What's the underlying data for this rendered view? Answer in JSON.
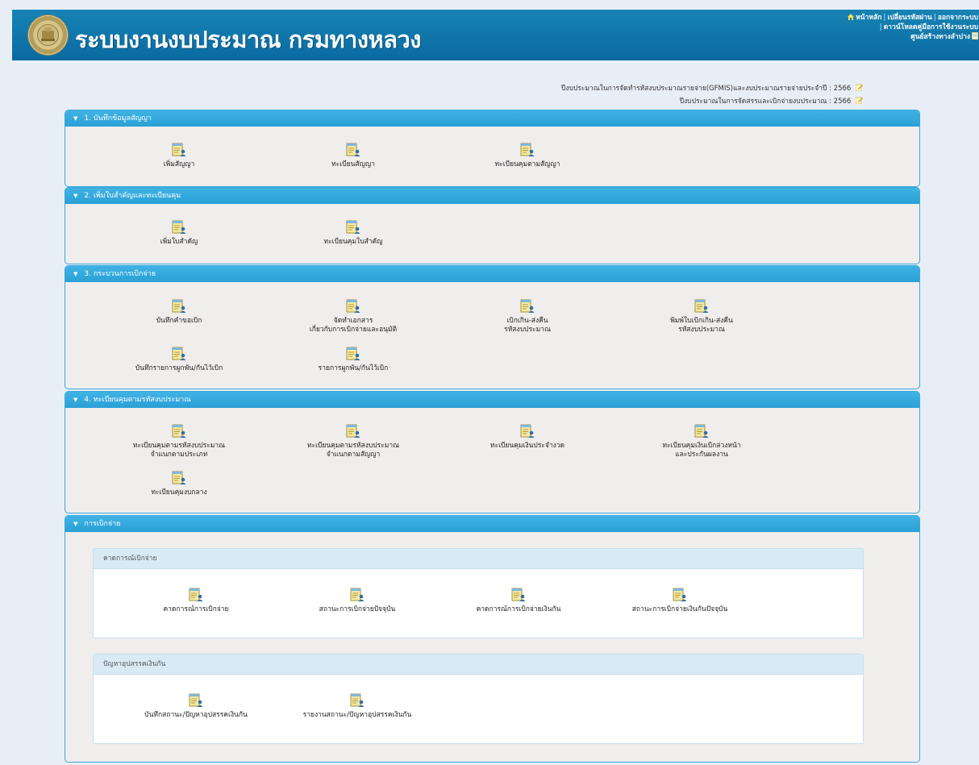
{
  "header": {
    "title": "ระบบงานงบประมาณ กรมทางหลวง",
    "links": {
      "home": "หน้าหลัก",
      "change_password": "เปลี่ยนรหัสผ่าน",
      "logout": "ออกจากระบบ",
      "download_manual": "ดาวน์โหลดคู่มือการใช้งานระบบ",
      "user_name": "ศูนย์สร้างทางลำปาง"
    }
  },
  "fiscal": {
    "line1_label": "ปีงบประมาณในการจัดทำรหัสงบประมาณรายจ่าย(GFMIS)และงบประมาณรายจ่ายประจำปี : 2566",
    "line2_label": "ปีงบประมาณในการจัดสรรและเบิกจ่ายงบประมาณ : 2566"
  },
  "panels": [
    {
      "title": "1. บันทึกข้อมูลสัญญา",
      "items": [
        "เพิ่มสัญญา",
        "ทะเบียนสัญญา",
        "ทะเบียนคุมตามสัญญา"
      ]
    },
    {
      "title": "2. เพิ่มใบสำคัญและทะเบียนคุม",
      "items": [
        "เพิ่มใบสำคัญ",
        "ทะเบียนคุมใบสำคัญ"
      ]
    },
    {
      "title": "3. กระบวนการเบิกจ่าย",
      "items": [
        {
          "l1": "บันทึกคำขอเบิก",
          "l2": ""
        },
        {
          "l1": "จัดทำเอกสาร",
          "l2": "เกี่ยวกับการเบิกจ่ายและอนุมัติ"
        },
        {
          "l1": "เบิกเกิน-ส่งคืน",
          "l2": "รหัสงบประมาณ"
        },
        {
          "l1": "พิมพ์ใบเบิกเกิน-ส่งคืน",
          "l2": "รหัสงบประมาณ"
        },
        {
          "l1": "บันทึกรายการผูกพัน/กันไว้เบิก",
          "l2": ""
        },
        {
          "l1": "รายการผูกพัน/กันไว้เบิก",
          "l2": ""
        }
      ]
    },
    {
      "title": "4. ทะเบียนคุมตามรหัสงบประมาณ",
      "items": [
        {
          "l1": "ทะเบียนคุมตามรหัสงบประมาณ",
          "l2": "จำแนกตามประเภท"
        },
        {
          "l1": "ทะเบียนคุมตามรหัสงบประมาณ",
          "l2": "จำแนกตามสัญญา"
        },
        {
          "l1": "ทะเบียนคุมเงินประจำงวด",
          "l2": ""
        },
        {
          "l1": "ทะเบียนคุมเงินเบิกล่วงหน้า",
          "l2": "และประกันผลงาน"
        },
        {
          "l1": "ทะเบียนคุมงบกลาง",
          "l2": ""
        }
      ]
    },
    {
      "title": "การเบิกจ่าย",
      "subpanels": [
        {
          "title": "คาดการณ์เบิกจ่าย",
          "items": [
            "คาดการณ์การเบิกจ่าย",
            "สถานะการเบิกจ่ายปัจจุบัน",
            "คาดการณ์การเบิกจ่ายเงินกัน",
            "สถานะการเบิกจ่ายเงินกันปัจจุบัน"
          ]
        },
        {
          "title": "ปัญหาอุปสรรคเงินกัน",
          "items": [
            "บันทึกสถานะ/ปัญหาอุปสรรคเงินกัน",
            "รายงานสถานะ/ปัญหาอุปสรรคเงินกัน"
          ]
        }
      ]
    }
  ],
  "colors": {
    "header_bg": "#0f78ad",
    "panel_head": "#35abe0",
    "panel_body": "#f0eded",
    "page_bg": "#e8eef6"
  },
  "icons": {
    "menu_item": "document-user-icon",
    "collapse": "triangle-down-icon",
    "home": "home-icon",
    "edit": "edit-icon"
  }
}
